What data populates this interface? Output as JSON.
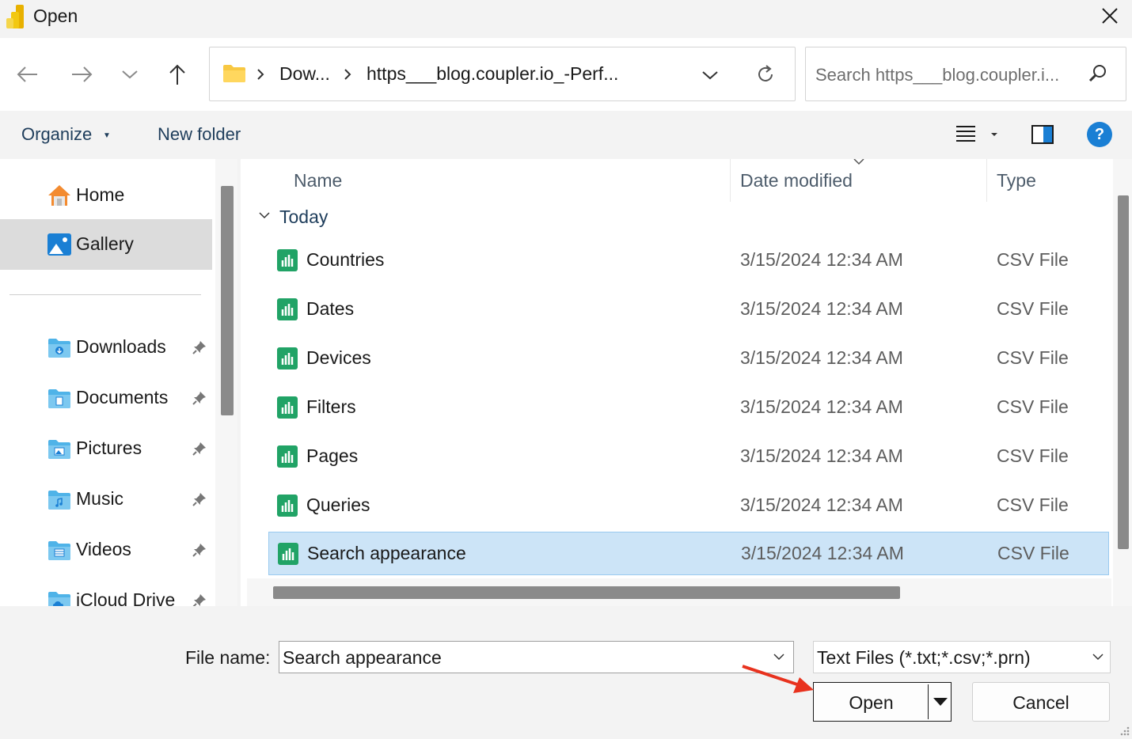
{
  "window": {
    "title": "Open",
    "app_icon": "power-bi-icon",
    "close_icon": "close-icon"
  },
  "navigation": {
    "back_icon": "arrow-left-icon",
    "forward_icon": "arrow-right-icon",
    "recent_icon": "chevron-down-icon",
    "up_icon": "arrow-up-icon",
    "breadcrumbs": [
      {
        "label": "Dow..."
      },
      {
        "label": "https___blog.coupler.io_-Perf..."
      }
    ],
    "refresh_icon": "refresh-icon",
    "search": {
      "placeholder": "Search https___blog.coupler.i...",
      "icon": "search-icon"
    }
  },
  "toolbar": {
    "organize_label": "Organize",
    "new_folder_label": "New folder",
    "view_icon": "list-view-icon",
    "pane_icon": "preview-pane-icon",
    "help_label": "?"
  },
  "sidebar": {
    "items": [
      {
        "label": "Home",
        "icon": "home-icon",
        "selected": false
      },
      {
        "label": "Gallery",
        "icon": "gallery-icon",
        "selected": true
      },
      {
        "label": "Downloads",
        "icon": "downloads-folder-icon",
        "pinned": true
      },
      {
        "label": "Documents",
        "icon": "documents-folder-icon",
        "pinned": true
      },
      {
        "label": "Pictures",
        "icon": "pictures-folder-icon",
        "pinned": true
      },
      {
        "label": "Music",
        "icon": "music-folder-icon",
        "pinned": true
      },
      {
        "label": "Videos",
        "icon": "videos-folder-icon",
        "pinned": true
      },
      {
        "label": "iCloud Drive",
        "icon": "icloud-folder-icon",
        "pinned": true
      }
    ]
  },
  "file_list": {
    "columns": {
      "name": "Name",
      "date": "Date modified",
      "type": "Type"
    },
    "group_label": "Today",
    "rows": [
      {
        "name": "Countries",
        "date": "3/15/2024 12:34 AM",
        "type": "CSV File",
        "selected": false
      },
      {
        "name": "Dates",
        "date": "3/15/2024 12:34 AM",
        "type": "CSV File",
        "selected": false
      },
      {
        "name": "Devices",
        "date": "3/15/2024 12:34 AM",
        "type": "CSV File",
        "selected": false
      },
      {
        "name": "Filters",
        "date": "3/15/2024 12:34 AM",
        "type": "CSV File",
        "selected": false
      },
      {
        "name": "Pages",
        "date": "3/15/2024 12:34 AM",
        "type": "CSV File",
        "selected": false
      },
      {
        "name": "Queries",
        "date": "3/15/2024 12:34 AM",
        "type": "CSV File",
        "selected": false
      },
      {
        "name": "Search appearance",
        "date": "3/15/2024 12:34 AM",
        "type": "CSV File",
        "selected": true
      }
    ]
  },
  "footer": {
    "file_name_label": "File name:",
    "file_name_value": "Search appearance",
    "file_type_value": "Text Files (*.txt;*.csv;*.prn)",
    "open_label": "Open",
    "cancel_label": "Cancel"
  },
  "colors": {
    "accent": "#1a7fd4",
    "selection": "#cce4f7",
    "annotation_arrow": "#e8321e",
    "csv_icon": "#21a366"
  }
}
